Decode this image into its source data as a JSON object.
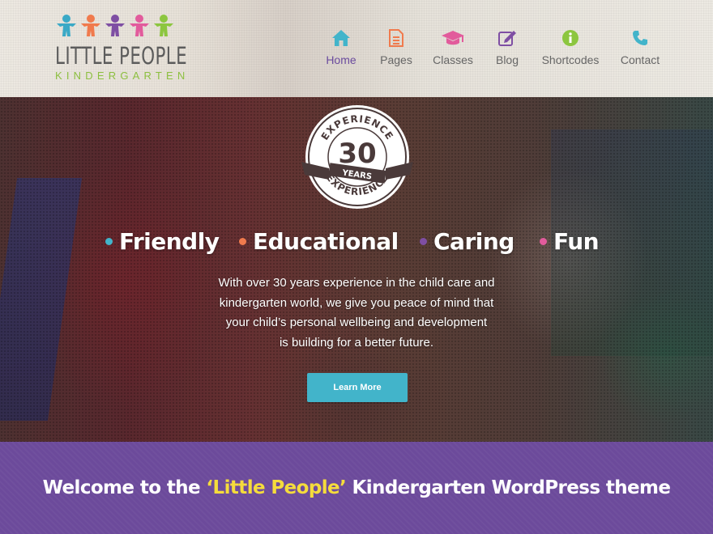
{
  "brand": {
    "title": "LITTLE PEOPLE",
    "subtitle": "KINDERGARTEN",
    "figure_colors": [
      "#3aa9c6",
      "#f07a4d",
      "#7e4ea3",
      "#e25b9c",
      "#8cc63f"
    ]
  },
  "nav": {
    "items": [
      {
        "label": "Home",
        "icon": "home-icon",
        "color": "#42b4ca",
        "active": true
      },
      {
        "label": "Pages",
        "icon": "document-icon",
        "color": "#f07a4d",
        "active": false
      },
      {
        "label": "Classes",
        "icon": "graduation-cap-icon",
        "color": "#e25b9c",
        "active": false
      },
      {
        "label": "Blog",
        "icon": "edit-icon",
        "color": "#7e4ea3",
        "active": false
      },
      {
        "label": "Shortcodes",
        "icon": "info-icon",
        "color": "#8cc63f",
        "active": false
      },
      {
        "label": "Contact",
        "icon": "phone-icon",
        "color": "#42b4ca",
        "active": false
      }
    ]
  },
  "hero": {
    "badge": {
      "number": "30",
      "top_text": "EXPERIENCE",
      "ribbon_text": "YEARS",
      "bottom_text": "EXPERIENCE"
    },
    "pillars": [
      {
        "text": "Friendly",
        "dot_color": "#42b4ca"
      },
      {
        "text": "Educational",
        "dot_color": "#f07a4d"
      },
      {
        "text": "Caring",
        "dot_color": "#7e4ea3"
      },
      {
        "text": "Fun",
        "dot_color": "#e25b9c"
      }
    ],
    "description": [
      "With over 30 years experience in the child care and",
      "kindergarten world, we give you peace of mind that",
      "your child’s personal wellbeing and development",
      "is building for a better future."
    ],
    "button_label": "Learn More"
  },
  "welcome": {
    "prefix": "Welcome to the ",
    "highlight": "‘Little People’",
    "suffix": " Kindergarten WordPress theme"
  }
}
